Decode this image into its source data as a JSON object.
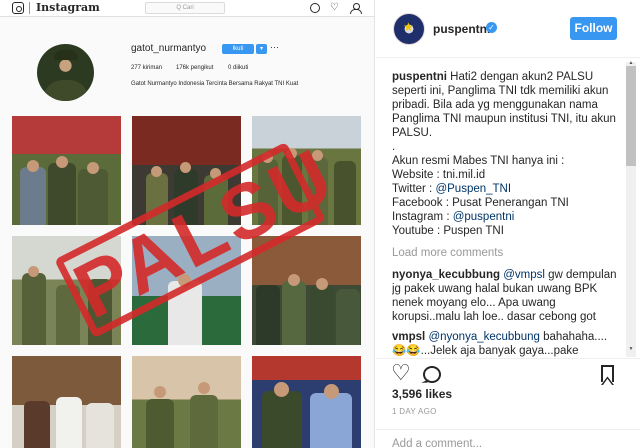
{
  "profile_screenshot": {
    "topbar": {
      "wordmark": "Instagram",
      "search_placeholder": "Q Cari"
    },
    "username": "gatot_nurmantyo",
    "follow_button": "Ikuti",
    "drop_button": "▾",
    "more": "···",
    "stats": {
      "posts": "277 kiriman",
      "followers": "176k pengikut",
      "following": "0 diikuti"
    },
    "bio": "Gatot Nurmantyo Indonesia Tercinta Bersama Rakyat TNI Kuat",
    "stamp_text": "PALSU"
  },
  "post": {
    "username": "puspentni",
    "follow_label": "Follow",
    "caption": {
      "username": "puspentni",
      "text_lead": "Hati2 dengan akun2 PALSU seperti ini, Panglima TNI tdk memiliki akun pribadi. Bila ada yg menggunakan nama Panglima TNI maupun institusi TNI, itu akun PALSU.",
      "dot": ".",
      "official_intro": "Akun resmi Mabes TNI hanya ini :",
      "website_label": "Website : ",
      "website_value": "tni.mil.id",
      "twitter_label": "Twitter : ",
      "twitter_value": "@Puspen_TNI",
      "facebook_label": "Facebook : ",
      "facebook_value": "Pusat Penerangan TNI",
      "instagram_label": "Instagram : ",
      "instagram_value": "@puspentni",
      "youtube_label": "Youtube : ",
      "youtube_value": "Puspen TNI"
    },
    "load_more": "Load more comments",
    "comments": [
      {
        "user": "nyonya_kecubbung",
        "mention": "@vmpsl",
        "text": " gw dempulan jg pakek uwang halal bukan uwang BPK nenek moyang elo... Apa uwang korupsi..malu lah loe.. dasar cebong got"
      },
      {
        "user": "vmpsl",
        "mention": "@nyonya_kecubbung",
        "text": " bahahaha....😂😂...Jelek aja banyak gaya...pake campuran"
      }
    ],
    "likes": "3,596 likes",
    "time": "1 DAY AGO",
    "add_comment_placeholder": "Add a comment..."
  },
  "colors": {
    "accent": "#3897f0",
    "stamp": "#d42a2a",
    "mention": "#003569"
  }
}
